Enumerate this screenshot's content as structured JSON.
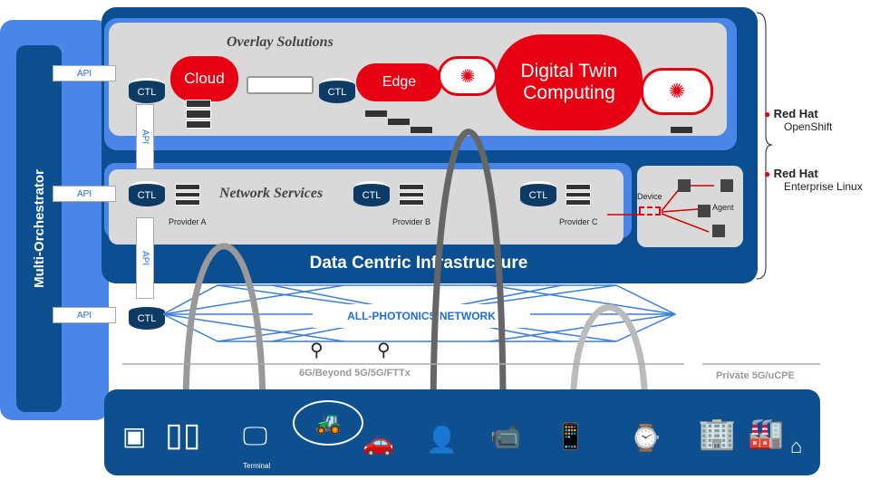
{
  "orchestrator": {
    "label": "Multi-Orchestrator"
  },
  "overlay": {
    "title": "Overlay Solutions",
    "cloud": "Cloud",
    "edge": "Edge",
    "digital_twin": "Digital Twin Computing"
  },
  "network": {
    "title": "Network Services",
    "providers": [
      "Provider A",
      "Provider B",
      "Provider C"
    ]
  },
  "dci": {
    "title": "Data Centric Infrastructure"
  },
  "ctl_label": "CTL",
  "api_label": "API",
  "device_panel": {
    "device": "Device",
    "agent": "Agent"
  },
  "photonics": {
    "label": "ALL-PHOTONICS NETWORK"
  },
  "access": {
    "public": "6G/Beyond 5G/5G/FTTx",
    "private": "Private 5G/uCPE"
  },
  "endpoints": {
    "terminal": "Terminal",
    "icons": [
      "chip-icon",
      "server-rack-icon",
      "terminal-icon",
      "tractor-icon",
      "car-icon",
      "person-icon",
      "camera-icon",
      "tablet-phone-icon",
      "smartwatch-icon",
      "building-icon",
      "factory-icon",
      "house-icon"
    ]
  },
  "brands": [
    {
      "name": "Red Hat",
      "product": "OpenShift"
    },
    {
      "name": "Red Hat",
      "product": "Enterprise Linux"
    }
  ],
  "colors": {
    "dark_blue": "#0b4f92",
    "light_blue": "#4a86e8",
    "red": "#e60012",
    "gray": "#d9d9d9"
  }
}
